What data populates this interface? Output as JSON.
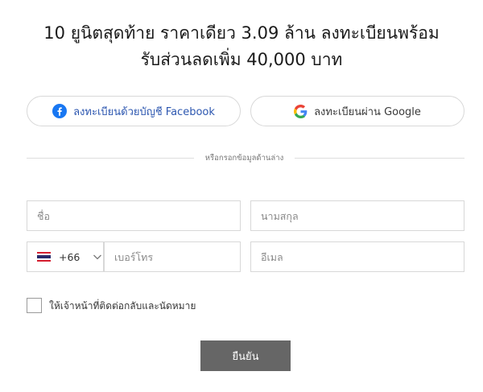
{
  "headline": {
    "line1": "10 ยูนิตสุดท้าย ราคาเดียว 3.09 ล้าน ลงทะเบียนพร้อม",
    "line2": "รับส่วนลดเพิ่ม 40,000 บาท"
  },
  "social": {
    "facebook_label": "ลงทะเบียนด้วยบัญชี Facebook",
    "google_label": "ลงทะเบียนผ่าน Google"
  },
  "divider_text": "หรือกรอกข้อมูลด้านล่าง",
  "form": {
    "first_name_placeholder": "ชื่อ",
    "last_name_placeholder": "นามสกุล",
    "country_dial_code": "+66",
    "phone_placeholder": "เบอร์โทร",
    "email_placeholder": "อีเมล",
    "consent_label": "ให้เจ้าหน้าที่ติดต่อกลับและนัดหมาย",
    "submit_label": "ยืนยัน"
  },
  "colors": {
    "facebook_blue": "#1877f2",
    "submit_bg": "#666666"
  },
  "icons": {
    "facebook": "facebook-icon",
    "google": "google-icon",
    "flag": "thailand-flag-icon",
    "chevron": "chevron-down-icon"
  }
}
